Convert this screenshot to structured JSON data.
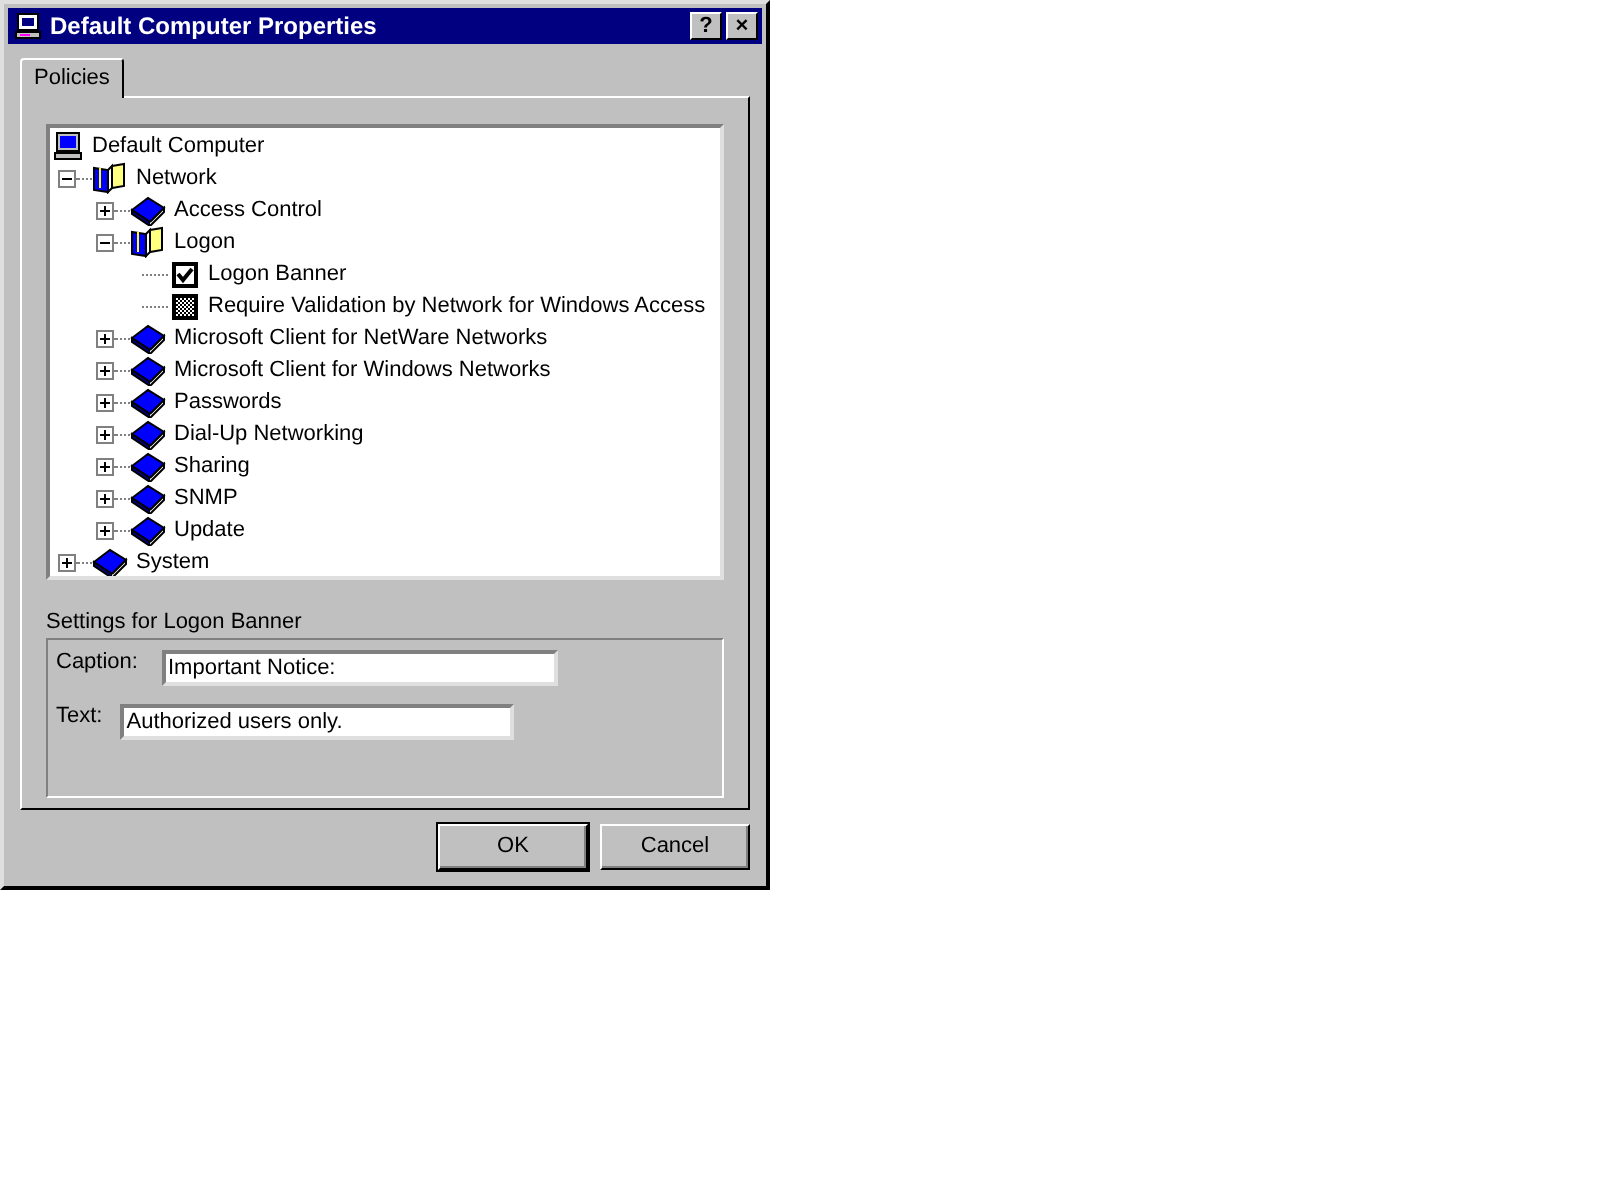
{
  "window": {
    "title": "Default Computer Properties",
    "title_buttons": [
      "?",
      "×"
    ]
  },
  "tabs": [
    {
      "label": "Policies",
      "selected": true
    }
  ],
  "tree": [
    {
      "label": "Default Computer",
      "kind": "computer",
      "children": [
        {
          "label": "Network",
          "kind": "category",
          "expanded": true,
          "children": [
            {
              "label": "Access Control",
              "kind": "category",
              "expanded": false
            },
            {
              "label": "Logon",
              "kind": "category",
              "expanded": true,
              "children": [
                {
                  "label": "Logon Banner",
                  "kind": "policy",
                  "checked": true
                },
                {
                  "label": "Require Validation by Network for Windows Access",
                  "kind": "policy",
                  "grayed": true
                }
              ]
            },
            {
              "label": "Microsoft Client for NetWare Networks",
              "kind": "category",
              "expanded": false
            },
            {
              "label": "Microsoft Client for Windows Networks",
              "kind": "category",
              "expanded": false
            },
            {
              "label": "Passwords",
              "kind": "category",
              "expanded": false
            },
            {
              "label": "Dial-Up Networking",
              "kind": "category",
              "expanded": false
            },
            {
              "label": "Sharing",
              "kind": "category",
              "expanded": false
            },
            {
              "label": "SNMP",
              "kind": "category",
              "expanded": false
            },
            {
              "label": "Update",
              "kind": "category",
              "expanded": false
            }
          ]
        },
        {
          "label": "System",
          "kind": "category",
          "expanded": false
        }
      ]
    }
  ],
  "settings": {
    "heading": "Settings for Logon Banner",
    "fields": [
      {
        "label": "Caption:",
        "value": "Important Notice:"
      },
      {
        "label": "Text:",
        "value": "Authorized users only."
      }
    ]
  },
  "buttons": [
    "OK",
    "Cancel"
  ]
}
